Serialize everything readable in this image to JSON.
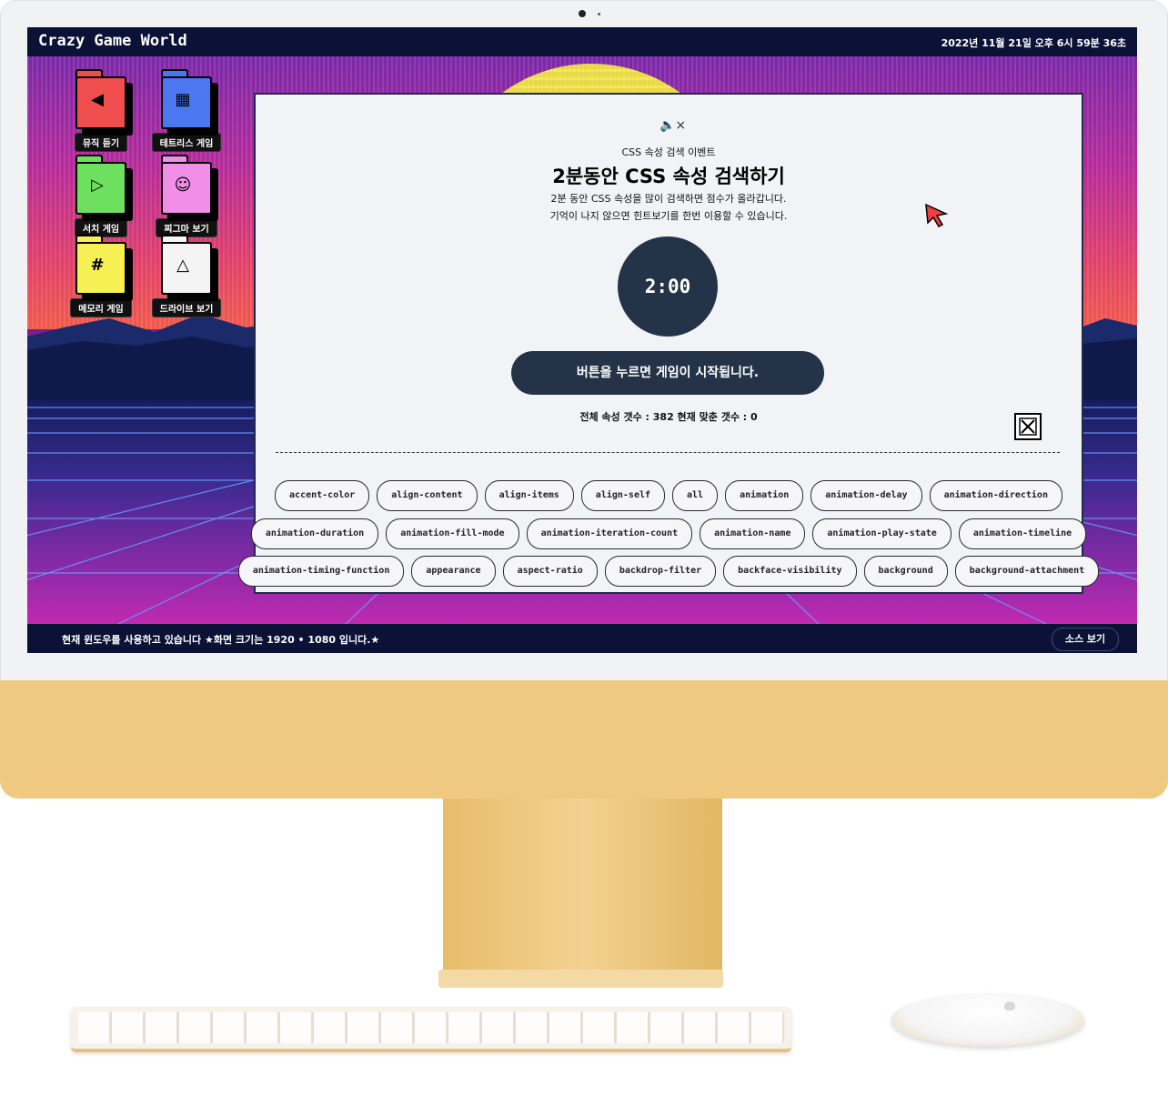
{
  "screen": {
    "app_title": "Crazy Game World",
    "clock": "2022년 11월 21일 오후 6시 59분 36초",
    "status_text": "현재 윈도우를 사용하고 있습니다 ★화면 크기는 1920 • 1080 입니다.★",
    "source_button": "소스 보기"
  },
  "desktop_icons": [
    {
      "label": "뮤직 듣기",
      "icon": "music-icon",
      "color": "#f04e4e"
    },
    {
      "label": "테트리스 게임",
      "icon": "file-icon",
      "color": "#4b78f0"
    },
    {
      "label": "서치 게임",
      "icon": "play-icon",
      "color": "#6ee060"
    },
    {
      "label": "찌그마 보기",
      "icon": "users-icon",
      "color": "#f08ee8"
    },
    {
      "label": "메모리 게임",
      "icon": "hash-icon",
      "color": "#f7f055"
    },
    {
      "label": "드라이브 보기",
      "icon": "graduation-icon",
      "color": "#f4f4f4"
    }
  ],
  "modal": {
    "subtitle": "CSS 속성 검색 이벤트",
    "title": "2분동안 CSS 속성 검색하기",
    "desc_line1": "2분 동안 CSS 속성을 많이 검색하면 점수가 올라갑니다.",
    "desc_line2": "기억이 나지 않으면 힌트보기를 한번 이용할 수 있습니다.",
    "timer": "2:00",
    "start_button": "버튼을 누르면 게임이 시작됩니다.",
    "counts": "전체 속성 갯수 : 382   현재 맞춘 갯수 : 0",
    "chips_row1": [
      "accent-color",
      "align-content",
      "align-items",
      "align-self",
      "all",
      "animation",
      "animation-delay",
      "animation-direction"
    ],
    "chips_row2": [
      "animation-duration",
      "animation-fill-mode",
      "animation-iteration-count",
      "animation-name",
      "animation-play-state",
      "animation-timeline"
    ],
    "chips_row3": [
      "animation-timing-function",
      "appearance",
      "aspect-ratio",
      "backdrop-filter",
      "backface-visibility",
      "background",
      "background-attachment"
    ]
  },
  "colors": {
    "bar": "#0c1236",
    "modal_accent": "#243348",
    "chin": "#efc97f"
  }
}
